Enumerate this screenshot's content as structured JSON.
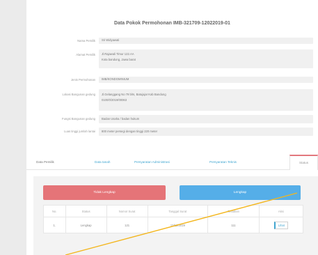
{
  "panel": {
    "title": "Data Pokok Permohonan IMB-321709-12022019-01"
  },
  "form": [
    {
      "label": "Nama Pemilik",
      "value": "Sri Widyawati"
    },
    {
      "label": "Alamat Pemilik",
      "value": "Jl.Rajawali Timur 122.AA",
      "value2": "Kota bandung, Jawa barat"
    },
    {
      "label": "Jenis Permohonan",
      "value": "IMB/KONDOMINIUM"
    },
    {
      "label": "Lokasi Bangunan gedung",
      "value": "Jl.Gelanggang No 79 blrs, Batujajar Kab Bandung",
      "value2": "0100/0/2019/00063"
    },
    {
      "label": "Fungsi Bangunan gedung",
      "value": "Badan Usaha / badan hukum"
    },
    {
      "label": "Luas tinggi jumlah lantai",
      "value": "800 meter persegi dengan tinggi 220 meter"
    }
  ],
  "tabs": [
    {
      "label": "Data Pemilik"
    },
    {
      "label": "Data tanah"
    },
    {
      "label": "Persyaratan Administrasi"
    },
    {
      "label": "Persyaratan Teknis"
    },
    {
      "label": "Status"
    }
  ],
  "status": {
    "btn_incomplete": "Tidak Lengkap",
    "btn_complete": "Lengkap",
    "table": {
      "headers": [
        "No.",
        "Status",
        "Nomor Surat",
        "Tanggal Surat",
        "Tindakan",
        "Aksi"
      ],
      "rows": [
        [
          "1.",
          "Lengkap",
          "121",
          "12/12/2019",
          "111",
          "Lihat"
        ]
      ]
    }
  },
  "colors": {
    "accent_blue": "#55aee8",
    "accent_red": "#e57478",
    "annotation_line": "#f3b61d"
  }
}
